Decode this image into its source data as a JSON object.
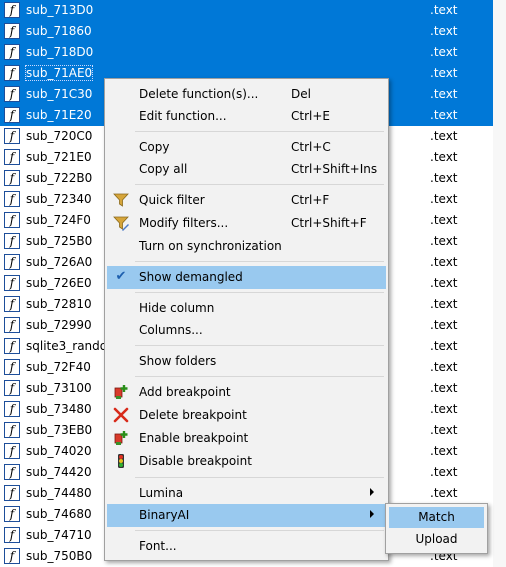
{
  "functions": [
    {
      "name": "sub_713D0",
      "segment": ".text",
      "selected": true
    },
    {
      "name": "sub_71860",
      "segment": ".text",
      "selected": true
    },
    {
      "name": "sub_718D0",
      "segment": ".text",
      "selected": true
    },
    {
      "name": "sub_71AE0",
      "segment": ".text",
      "selected": true,
      "focused": true
    },
    {
      "name": "sub_71C30",
      "segment": ".text",
      "selected": true
    },
    {
      "name": "sub_71E20",
      "segment": ".text",
      "selected": true
    },
    {
      "name": "sub_720C0",
      "segment": ".text",
      "selected": false
    },
    {
      "name": "sub_721E0",
      "segment": ".text",
      "selected": false
    },
    {
      "name": "sub_722B0",
      "segment": ".text",
      "selected": false
    },
    {
      "name": "sub_72340",
      "segment": ".text",
      "selected": false
    },
    {
      "name": "sub_724F0",
      "segment": ".text",
      "selected": false
    },
    {
      "name": "sub_725B0",
      "segment": ".text",
      "selected": false
    },
    {
      "name": "sub_726A0",
      "segment": ".text",
      "selected": false
    },
    {
      "name": "sub_726E0",
      "segment": ".text",
      "selected": false
    },
    {
      "name": "sub_72810",
      "segment": ".text",
      "selected": false
    },
    {
      "name": "sub_72990",
      "segment": ".text",
      "selected": false
    },
    {
      "name": "sqlite3_rando",
      "segment": ".text",
      "selected": false
    },
    {
      "name": "sub_72F40",
      "segment": ".text",
      "selected": false
    },
    {
      "name": "sub_73100",
      "segment": ".text",
      "selected": false
    },
    {
      "name": "sub_73480",
      "segment": ".text",
      "selected": false
    },
    {
      "name": "sub_73EB0",
      "segment": ".text",
      "selected": false
    },
    {
      "name": "sub_74020",
      "segment": ".text",
      "selected": false
    },
    {
      "name": "sub_74420",
      "segment": ".text",
      "selected": false
    },
    {
      "name": "sub_74480",
      "segment": ".text",
      "selected": false
    },
    {
      "name": "sub_74680",
      "segment": ".text",
      "selected": false
    },
    {
      "name": "sub_74710",
      "segment": ".text",
      "selected": false
    },
    {
      "name": "sub_750B0",
      "segment": ".text",
      "selected": false
    }
  ],
  "context_menu": {
    "delete_function": {
      "label": "Delete function(s)...",
      "shortcut": "Del"
    },
    "edit_function": {
      "label": "Edit function...",
      "shortcut": "Ctrl+E"
    },
    "copy": {
      "label": "Copy",
      "shortcut": "Ctrl+C"
    },
    "copy_all": {
      "label": "Copy all",
      "shortcut": "Ctrl+Shift+Ins"
    },
    "quick_filter": {
      "label": "Quick filter",
      "shortcut": "Ctrl+F"
    },
    "modify_filters": {
      "label": "Modify filters...",
      "shortcut": "Ctrl+Shift+F"
    },
    "sync": {
      "label": "Turn on synchronization"
    },
    "show_demangled": {
      "label": "Show demangled",
      "checked": true
    },
    "hide_column": {
      "label": "Hide column"
    },
    "columns": {
      "label": "Columns..."
    },
    "show_folders": {
      "label": "Show folders"
    },
    "add_breakpoint": {
      "label": "Add breakpoint"
    },
    "delete_breakpoint": {
      "label": "Delete breakpoint"
    },
    "enable_breakpoint": {
      "label": "Enable breakpoint"
    },
    "disable_breakpoint": {
      "label": "Disable breakpoint"
    },
    "lumina": {
      "label": "Lumina"
    },
    "binaryai": {
      "label": "BinaryAI"
    },
    "font": {
      "label": "Font..."
    }
  },
  "binaryai_submenu": {
    "match": "Match",
    "upload": "Upload"
  },
  "colors": {
    "selection": "#0078d7",
    "menu_highlight": "#99c9ef",
    "menu_background": "#f2f2f2"
  }
}
